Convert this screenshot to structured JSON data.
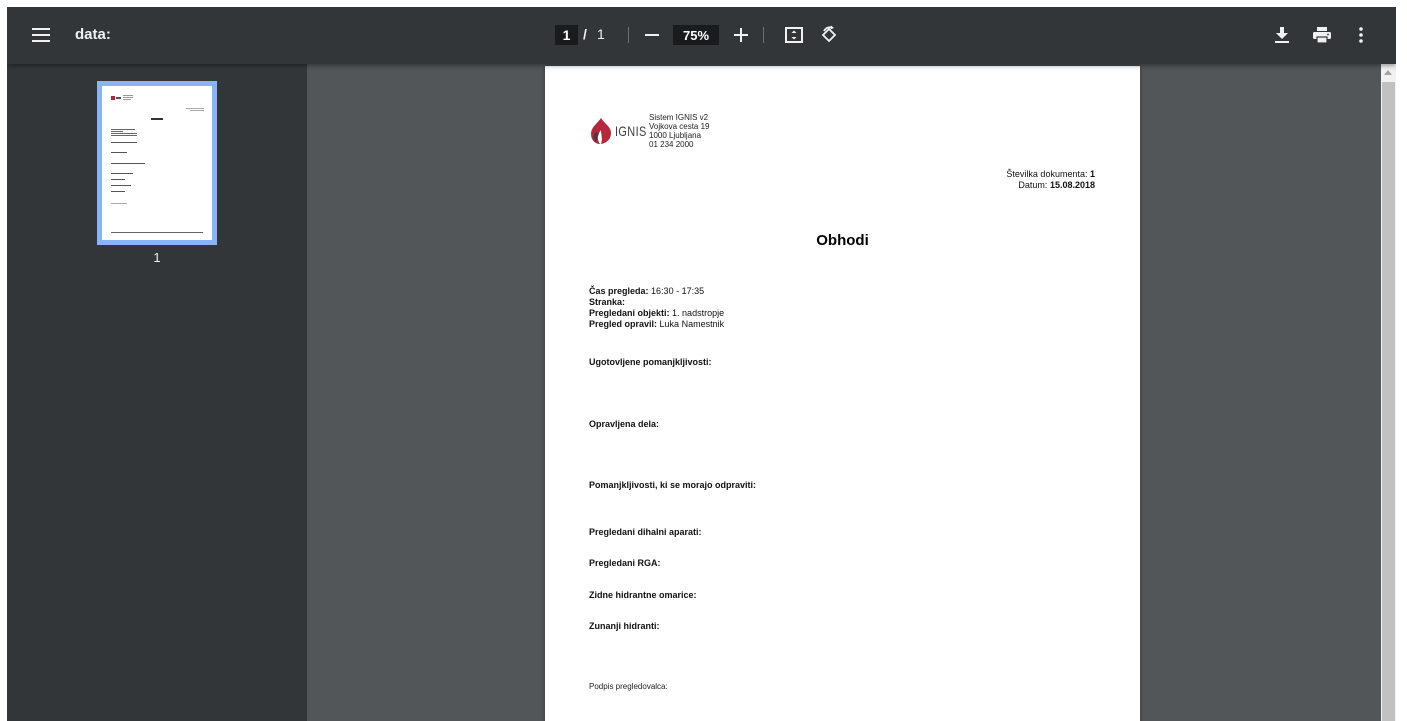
{
  "toolbar": {
    "title": "data:",
    "current_page": "1",
    "separator": "/",
    "total_pages": "1",
    "zoom": "75%"
  },
  "sidebar": {
    "thumbnail_label": "1"
  },
  "document": {
    "logo_text": "IGNIS",
    "company": {
      "line1": "Sistem IGNIS v2",
      "line2": "Vojkova cesta 19",
      "line3": "1000 Ljubljana",
      "line4": "01 234 2000"
    },
    "meta": {
      "doc_number_label": "Številka dokumenta:",
      "doc_number_value": "1",
      "date_label": "Datum:",
      "date_value": "15.08.2018"
    },
    "heading": "Obhodi",
    "info": {
      "time_label": "Čas pregleda:",
      "time_value": "16:30 - 17:35",
      "client_label": "Stranka:",
      "objects_label": "Pregledani objekti:",
      "objects_value": "1. nadstropje",
      "inspector_label": "Pregled opravil:",
      "inspector_value": "Luka Namestnik"
    },
    "sections": [
      "Ugotovljene pomanjkljivosti:",
      "Opravljena dela:",
      "Pomanjkljivosti, ki se morajo odpraviti:",
      "Pregledani dihalni aparati:",
      "Pregledani RGA:",
      "Zidne hidrantne omarice:",
      "Zunanji hidranti:"
    ],
    "signature_label": "Podpis pregledovalca:"
  },
  "colors": {
    "toolbar_bg": "#323639",
    "viewer_bg": "#525659",
    "thumb_selected": "#8ab4f8",
    "logo_red": "#b3283a",
    "logo_dark": "#3e3f42"
  },
  "icons": [
    "menu-icon",
    "zoom-out-icon",
    "zoom-in-icon",
    "fit-page-icon",
    "rotate-icon",
    "download-icon",
    "print-icon",
    "more-vert-icon"
  ]
}
